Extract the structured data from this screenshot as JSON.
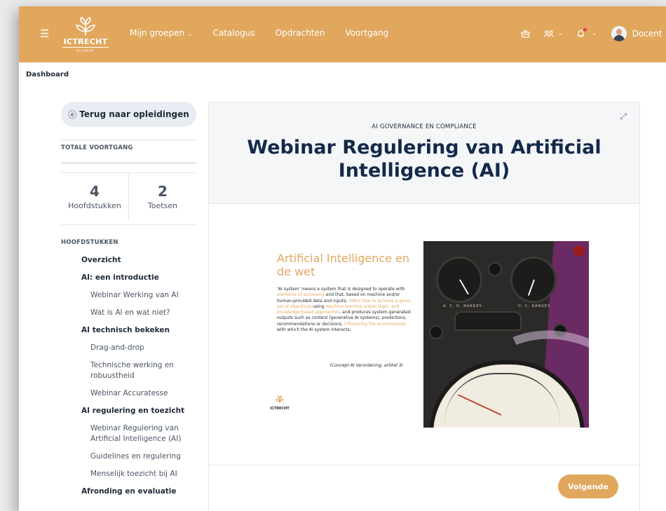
{
  "header": {
    "logo_text": "ICTRECHT",
    "logo_sub": "ACADEMY",
    "nav": [
      {
        "label": "Mijn groepen",
        "has_dropdown": true
      },
      {
        "label": "Catalogus"
      },
      {
        "label": "Opdrachten"
      },
      {
        "label": "Voortgang"
      }
    ],
    "user_label": "Docent",
    "icons": {
      "menu": "hamburger-icon",
      "cart": "basket-icon",
      "people": "users-icon",
      "bell": "bell-icon"
    },
    "colors": {
      "brand": "#e0a75d",
      "notification": "#e0403c"
    }
  },
  "breadcrumb": "Dashboard",
  "sidebar": {
    "back_label": "Terug naar opleidingen",
    "progress_label": "TOTALE VOORTGANG",
    "progress_value": 0,
    "stats": [
      {
        "value": "4",
        "label": "Hoofdstukken"
      },
      {
        "value": "2",
        "label": "Toetsen"
      }
    ],
    "chapters_label": "HOOFDSTUKKEN",
    "toc": [
      {
        "type": "chapter",
        "label": "Overzicht"
      },
      {
        "type": "chapter",
        "label": "AI: een introductie"
      },
      {
        "type": "lesson",
        "label": "Webinar Werking van AI"
      },
      {
        "type": "lesson",
        "label": "Wat is AI en wat niet?"
      },
      {
        "type": "chapter",
        "label": "AI technisch bekeken"
      },
      {
        "type": "lesson",
        "label": "Drag-and-drop"
      },
      {
        "type": "lesson",
        "label": "Technische werking en robuustheid"
      },
      {
        "type": "lesson",
        "label": "Webinar Accuratesse"
      },
      {
        "type": "chapter",
        "label": "AI regulering en toezicht"
      },
      {
        "type": "lesson",
        "label": "Webinar Regulering van Artificial Intelligence (AI)"
      },
      {
        "type": "lesson",
        "label": "Guidelines en regulering"
      },
      {
        "type": "lesson",
        "label": "Menselijk toezicht bij AI"
      },
      {
        "type": "chapter",
        "label": "Afronding en evaluatie"
      }
    ]
  },
  "main": {
    "subtitle": "AI GOVERNANCE EN COMPLIANCE",
    "title": "Webinar Regulering van Artificial Intelligence (AI)",
    "slide": {
      "title": "Artificial Intelligence en de wet",
      "body_parts": [
        {
          "text": "‘AI system’ means a system that is designed to operate with ",
          "hl": false
        },
        {
          "text": "elements of autonomy",
          "hl": true
        },
        {
          "text": " and that, based on machine and/or human-provided data and inputs, ",
          "hl": false
        },
        {
          "text": "infers how to achieve a given set of objectives",
          "hl": true
        },
        {
          "text": " using ",
          "hl": false
        },
        {
          "text": "machine learning and/or logic- and knowledge based approaches",
          "hl": true
        },
        {
          "text": ", and produces system-generated outputs such as content (generative AI systems), predictions, recommendations or decisions, ",
          "hl": false
        },
        {
          "text": "influencing the environments",
          "hl": true
        },
        {
          "text": " with which the AI system interacts;",
          "hl": false
        }
      ],
      "citation": "(Concept AI Verordening, artikel 3)",
      "logo_text": "ICTRECHT",
      "photo_plate_left": "A. C. D. RANGES",
      "photo_plate_right": "D. C. RANGES"
    },
    "next_label": "Volgende"
  }
}
